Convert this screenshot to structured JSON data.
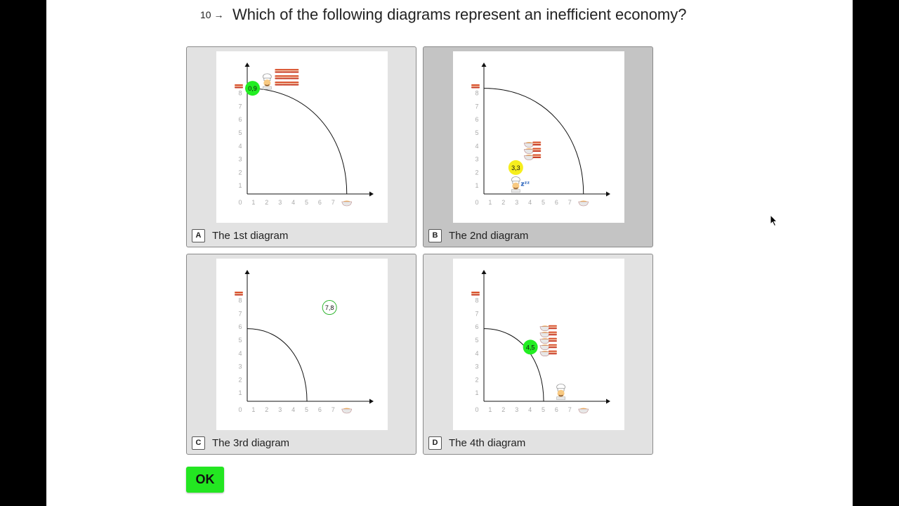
{
  "question": {
    "number": "10",
    "arrow_icon": "right-arrow-icon",
    "text": "Which of the following diagrams represent an inefficient economy?"
  },
  "choices": [
    {
      "key": "A",
      "label": "The 1st diagram",
      "selected": false,
      "curve_intercepts": {
        "x": 7.5,
        "y": 8
      },
      "point": {
        "label": "0,9",
        "x": 0.4,
        "y": 8,
        "fill": "#22ee22",
        "outline_only": false
      },
      "chef": {
        "x": 1.5,
        "y": 8.4,
        "sleeping": false
      },
      "product_rows": [
        [
          "bacon",
          "bacon",
          "bacon"
        ],
        [
          "bacon",
          "bacon",
          "bacon"
        ],
        [
          "bacon",
          "bacon",
          "bacon"
        ]
      ],
      "product_origin": {
        "x": 2.4,
        "y": 9.3
      }
    },
    {
      "key": "B",
      "label": "The 2nd diagram",
      "selected": true,
      "curve_intercepts": {
        "x": 7.5,
        "y": 8
      },
      "point": {
        "label": "3,3",
        "x": 2.4,
        "y": 2,
        "fill": "#f6ee1e",
        "outline_only": false
      },
      "chef": {
        "x": 2.4,
        "y": 0.6,
        "sleeping": true
      },
      "product_rows": [
        [
          "bowl",
          "bacon"
        ],
        [
          "bowl",
          "bacon"
        ],
        [
          "bowl",
          "bacon"
        ]
      ],
      "product_origin": {
        "x": 3.4,
        "y": 3.8
      }
    },
    {
      "key": "C",
      "label": "The 3rd diagram",
      "selected": false,
      "curve_intercepts": {
        "x": 4.5,
        "y": 5.5
      },
      "point": {
        "label": "7,8",
        "x": 6.2,
        "y": 7.1,
        "fill": "#ffffff",
        "outline_only": true
      },
      "chef": null,
      "product_rows": [],
      "product_origin": {
        "x": 0,
        "y": 0
      }
    },
    {
      "key": "D",
      "label": "The 4th diagram",
      "selected": false,
      "curve_intercepts": {
        "x": 4.5,
        "y": 5.5
      },
      "point": {
        "label": "4,5",
        "x": 3.5,
        "y": 4.1,
        "fill": "#22ee22",
        "outline_only": false
      },
      "chef": {
        "x": 5.8,
        "y": 0.6,
        "sleeping": false
      },
      "product_rows": [
        [
          "bowl",
          "bacon"
        ],
        [
          "bowl",
          "bacon"
        ],
        [
          "bowl",
          "bacon"
        ],
        [
          "bowl",
          "bacon"
        ],
        [
          "bowl",
          "bacon"
        ]
      ],
      "product_origin": {
        "x": 4.6,
        "y": 5.6
      }
    }
  ],
  "axis": {
    "x_ticks": [
      "0",
      "1",
      "2",
      "3",
      "4",
      "5",
      "6",
      "7"
    ],
    "y_ticks": [
      "1",
      "2",
      "3",
      "4",
      "5",
      "6",
      "7",
      "8"
    ],
    "x_icon": "bowl-icon",
    "y_icon": "bacon-icon"
  },
  "ok_button": {
    "label": "OK",
    "color": "#23e621"
  },
  "colors": {
    "selected_card": "#c4c4c4",
    "card": "#e2e2e2"
  }
}
